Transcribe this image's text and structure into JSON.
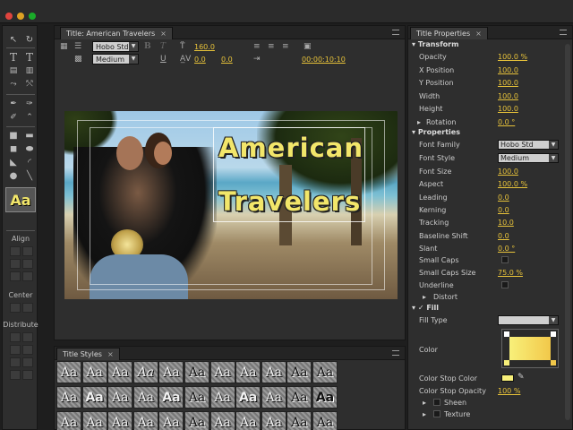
{
  "editor_tab": {
    "label": "Title: American Travelers",
    "close": "×"
  },
  "title_toolbar": {
    "font_family": "Hobo Std",
    "font_style": "Medium",
    "font_size": "160.0",
    "tracking": "0.0",
    "leading": "0.0",
    "timecode": "00:00:10:10"
  },
  "canvas": {
    "line1": "American",
    "line2": "Travelers"
  },
  "tools": {
    "align_label": "Align",
    "center_label": "Center",
    "distribute_label": "Distribute",
    "style_preview": "Aa"
  },
  "styles_tab": {
    "label": "Title Styles",
    "close": "×",
    "swatch_text": "Aa"
  },
  "props_tab": {
    "label": "Title Properties",
    "close": "×"
  },
  "transform": {
    "header": "Transform",
    "rows": [
      {
        "label": "Opacity",
        "value": "100.0 %"
      },
      {
        "label": "X Position",
        "value": "100.0"
      },
      {
        "label": "Y Position",
        "value": "100.0"
      },
      {
        "label": "Width",
        "value": "100.0"
      },
      {
        "label": "Height",
        "value": "100.0"
      },
      {
        "label": "Rotation",
        "value": "0.0 °"
      }
    ]
  },
  "properties": {
    "header": "Properties",
    "font_family_label": "Font Family",
    "font_family": "Hobo Std",
    "font_style_label": "Font Style",
    "font_style": "Medium",
    "rows": [
      {
        "label": "Font Size",
        "value": "100.0"
      },
      {
        "label": "Aspect",
        "value": "100.0 %"
      },
      {
        "label": "Leading",
        "value": "0.0"
      },
      {
        "label": "Kerning",
        "value": "0.0"
      },
      {
        "label": "Tracking",
        "value": "10.0"
      },
      {
        "label": "Baseline Shift",
        "value": "0.0"
      },
      {
        "label": "Slant",
        "value": "0.0 °"
      }
    ],
    "small_caps": "Small Caps",
    "small_caps_size": "Small Caps Size",
    "small_caps_size_value": "75.0 %",
    "underline": "Underline",
    "distort": "Distort"
  },
  "fill": {
    "header": "Fill",
    "fill_type": "Fill Type",
    "color": "Color",
    "color_stop_color": "Color Stop Color",
    "color_stop_opacity": "Color Stop Opacity",
    "color_stop_opacity_value": "100 %",
    "sheen": "Sheen",
    "texture": "Texture"
  },
  "colors": {
    "accent": "#e8c33a",
    "title_fill": "#f2e66a",
    "panel": "#2e2e2e"
  }
}
